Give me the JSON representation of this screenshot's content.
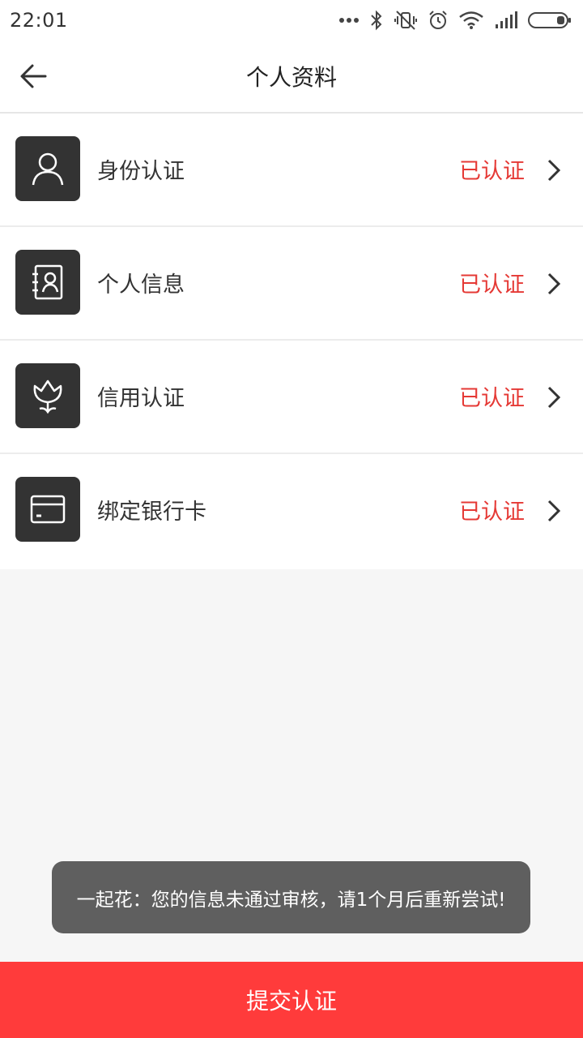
{
  "status_bar": {
    "time": "22:01"
  },
  "header": {
    "title": "个人资料"
  },
  "items": [
    {
      "label": "身份认证",
      "status": "已认证",
      "icon": "person-icon"
    },
    {
      "label": "个人信息",
      "status": "已认证",
      "icon": "contact-card-icon"
    },
    {
      "label": "信用认证",
      "status": "已认证",
      "icon": "tulip-icon"
    },
    {
      "label": "绑定银行卡",
      "status": "已认证",
      "icon": "bank-card-icon"
    }
  ],
  "toast": {
    "text": "一起花：您的信息未通过审核，请1个月后重新尝试!"
  },
  "submit": {
    "label": "提交认证"
  },
  "colors": {
    "accent": "#ff3b3b",
    "status_verified": "#e53935",
    "icon_bg": "#333333",
    "toast_bg": "#5f5f5f"
  }
}
